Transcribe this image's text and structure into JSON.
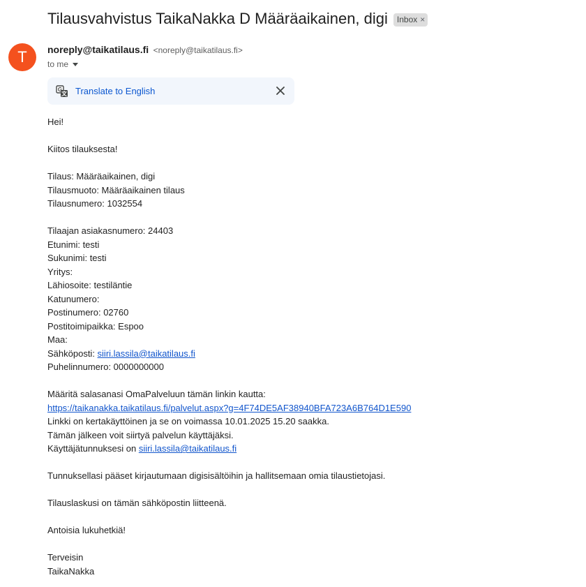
{
  "subject": "Tilausvahvistus TaikaNakka D Määräaikainen, digi",
  "label": {
    "text": "Inbox",
    "close": "×"
  },
  "avatar": {
    "letter": "T",
    "color": "#f4511e"
  },
  "sender": {
    "name": "noreply@taikatilaus.fi",
    "email": "<noreply@taikatilaus.fi>"
  },
  "recipient": {
    "to": "to me"
  },
  "translate": {
    "icon": "translate-icon",
    "label": "Translate to English"
  },
  "body": {
    "greeting": "Hei!",
    "thanks": "Kiitos tilauksesta!",
    "order_lines": [
      "Tilaus: Määräaikainen, digi",
      "Tilausmuoto: Määräaikainen tilaus",
      "Tilausnumero: 1032554"
    ],
    "customer_lines": [
      "Tilaajan asiakasnumero: 24403",
      "Etunimi: testi",
      "Sukunimi: testi",
      "Yritys:",
      "Lähiosoite: testiläntie",
      "Katunumero:",
      "Postinumero: 02760",
      "Postitoimipaikka: Espoo",
      "Maa:"
    ],
    "email_label": "Sähköposti: ",
    "email": "siiri.lassila@taikatilaus.fi",
    "phone": "Puhelinnumero: 0000000000",
    "password_intro": "Määritä salasanasi OmaPalveluun tämän linkin kautta:",
    "password_link": "https://taikanakka.taikatilaus.fi/palvelut.aspx?g=4F74DE5AF38940BFA723A6B764D1E590",
    "link_validity": "Linkki on kertakäyttöinen ja se on voimassa 10.01.2025 15.20 saakka.",
    "after_that": "Tämän jälkeen voit siirtyä palvelun käyttäjäksi.",
    "username_label": "Käyttäjätunnuksesi on ",
    "username": "siiri.lassila@taikatilaus.fi",
    "access_info": "Tunnuksellasi pääset kirjautumaan digisisältöihin ja hallitsemaan omia tilaustietojasi.",
    "invoice_info": "Tilauslaskusi on tämän sähköpostin liitteenä.",
    "closing": "Antoisia lukuhetkiä!",
    "regards": "Terveisin",
    "signature": "TaikaNakka"
  }
}
